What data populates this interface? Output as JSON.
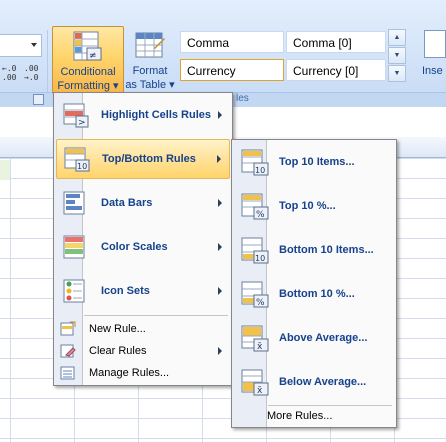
{
  "ribbon": {
    "conditional_formatting": {
      "line1": "Conditional",
      "line2": "Formatting ▾"
    },
    "format_as_table": {
      "line1": "Format",
      "line2": "as Table ▾"
    },
    "decimal_increase": "←.0\n.00",
    "decimal_decrease": ".00\n→.0",
    "cell_styles": [
      "Comma",
      "Comma [0]",
      "Currency",
      "Currency [0]"
    ],
    "styles_group_label": "les",
    "insert_label": "Inse"
  },
  "cf_menu": {
    "items": [
      {
        "label": "Highlight Cells Rules",
        "icon": "highlight-cells-rules-icon",
        "mnemonic": "H"
      },
      {
        "label": "Top/Bottom Rules",
        "icon": "top-bottom-rules-icon",
        "mnemonic": "T"
      },
      {
        "label": "Data Bars",
        "icon": "data-bars-icon",
        "mnemonic": "D"
      },
      {
        "label": "Color Scales",
        "icon": "color-scales-icon",
        "mnemonic": "S"
      },
      {
        "label": "Icon Sets",
        "icon": "icon-sets-icon",
        "mnemonic": "I"
      }
    ],
    "small_items": [
      {
        "label": "New Rule...",
        "icon": "new-rule-icon"
      },
      {
        "label": "Clear Rules",
        "icon": "clear-rules-icon"
      },
      {
        "label": "Manage Rules...",
        "icon": "manage-rules-icon"
      }
    ]
  },
  "topbottom_menu": {
    "items": [
      {
        "label": "Top 10 Items...",
        "icon": "top-10-items-icon",
        "badge": "10"
      },
      {
        "label": "Top 10 %...",
        "icon": "top-10-percent-icon",
        "badge": "%"
      },
      {
        "label": "Bottom 10 Items...",
        "icon": "bottom-10-items-icon",
        "badge": "10"
      },
      {
        "label": "Bottom 10 %...",
        "icon": "bottom-10-percent-icon",
        "badge": "%"
      },
      {
        "label": "Above Average...",
        "icon": "above-average-icon",
        "badge": "x̄"
      },
      {
        "label": "Below Average...",
        "icon": "below-average-icon",
        "badge": "x̄"
      }
    ],
    "more_rules": "More Rules..."
  },
  "colors": {
    "highlight": "#ffd46a",
    "ribbon": "#d3e3f8",
    "text": "#15428b"
  }
}
